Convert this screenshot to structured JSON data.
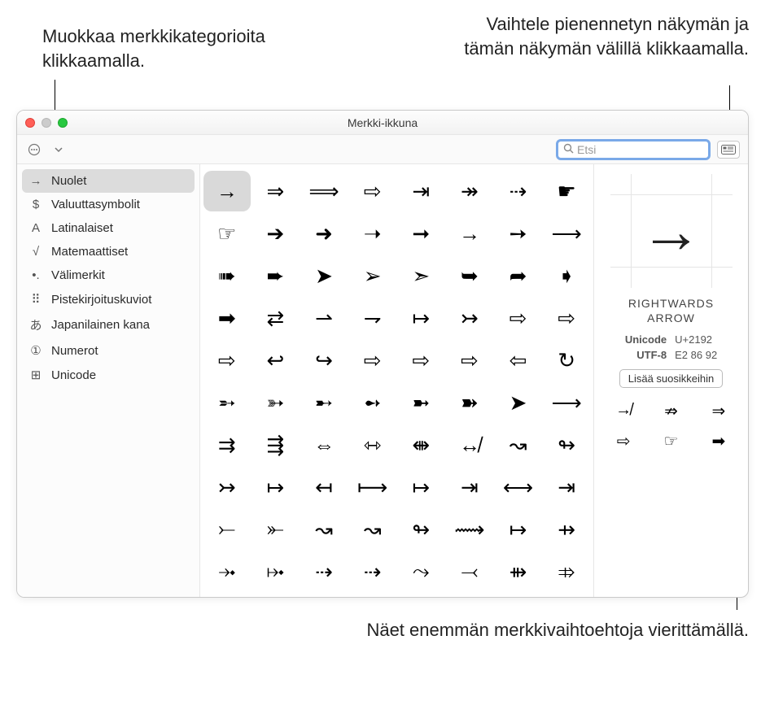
{
  "callouts": {
    "edit_categories": "Muokkaa merkkikategorioita klikkaamalla.",
    "toggle_view": "Vaihtele pienennetyn näkymän ja tämän näkymän välillä klikkaamalla.",
    "scroll_more": "Näet enemmän merkkivaihtoehtoja vierittämällä."
  },
  "window": {
    "title": "Merkki-ikkuna",
    "search_placeholder": "Etsi"
  },
  "sidebar": [
    {
      "icon": "→",
      "label": "Nuolet",
      "selected": true
    },
    {
      "icon": "$",
      "label": "Valuuttasymbolit"
    },
    {
      "icon": "A",
      "label": "Latinalaiset"
    },
    {
      "icon": "√",
      "label": "Matemaattiset"
    },
    {
      "icon": "•.",
      "label": "Välimerkit"
    },
    {
      "icon": "⠿",
      "label": "Pistekirjoituskuviot"
    },
    {
      "icon": "あ",
      "label": "Japanilainen kana"
    },
    {
      "icon": "①",
      "label": "Numerot"
    },
    {
      "icon": "⊞",
      "label": "Unicode"
    }
  ],
  "grid": [
    [
      "→",
      "⇒",
      "⟹",
      "⇨",
      "⇥",
      "↠",
      "⇢",
      "☛"
    ],
    [
      "☞",
      "➔",
      "➜",
      "➝",
      "➞",
      "→",
      "➙",
      "⟶"
    ],
    [
      "➠",
      "➨",
      "➤",
      "➢",
      "➣",
      "➥",
      "➦",
      "➧"
    ],
    [
      "➡",
      "⇄",
      "⇀",
      "⇁",
      "↦",
      "↣",
      "⇨",
      "⇨"
    ],
    [
      "⇨",
      "↩",
      "↪",
      "⇨",
      "⇨",
      "⇨",
      "⇦",
      "↻"
    ],
    [
      "➵",
      "➳",
      "➸",
      "➻",
      "➼",
      "➽",
      "➤",
      "⟶"
    ],
    [
      "⇉",
      "⇶",
      "⇔",
      "⇿",
      "⇼",
      "↮",
      "↝",
      "↬"
    ],
    [
      "↣",
      "↦",
      "↤",
      "⟼",
      "↦",
      "⇥",
      "⟷",
      "⇥"
    ],
    [
      "⤚",
      "⤜",
      "↝",
      "↝",
      "↬",
      "⟿",
      "↦",
      "⇸"
    ],
    [
      "⤞",
      "⤠",
      "⇢",
      "⇢",
      "⤳",
      "⤙",
      "⇻",
      "⤃"
    ]
  ],
  "detail": {
    "big": "→",
    "name_line1": "RIGHTWARDS",
    "name_line2": "ARROW",
    "unicode_label": "Unicode",
    "unicode_value": "U+2192",
    "utf8_label": "UTF-8",
    "utf8_value": "E2 86 92",
    "favorite_button": "Lisää suosikkeihin",
    "variants": [
      "↛",
      "⇏",
      "⇒",
      "⇨",
      "☞",
      "➡"
    ]
  }
}
